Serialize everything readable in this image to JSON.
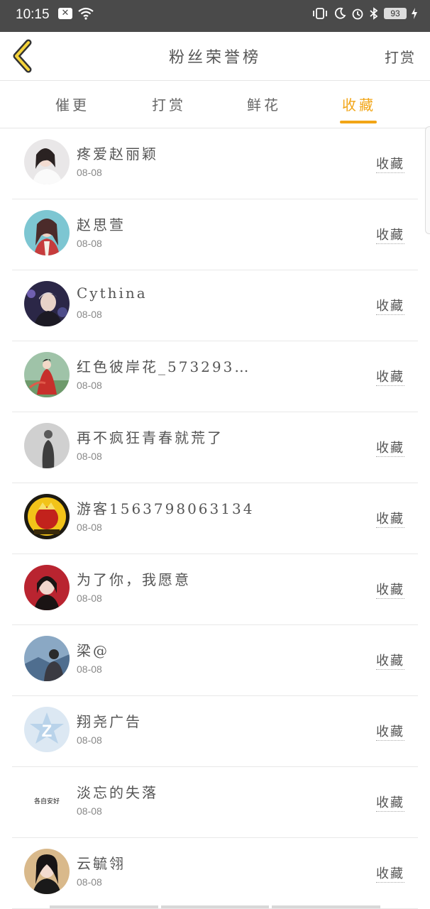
{
  "status_bar": {
    "time": "10:15",
    "battery": "93"
  },
  "header": {
    "title": "粉丝荣誉榜",
    "action": "打赏"
  },
  "tabs": [
    {
      "label": "催更"
    },
    {
      "label": "打赏"
    },
    {
      "label": "鲜花"
    },
    {
      "label": "收藏"
    }
  ],
  "active_tab": "收藏",
  "accent_color": "#f2a516",
  "rows": [
    {
      "name": "疼爱赵丽颖",
      "date": "08-08",
      "action": "收藏"
    },
    {
      "name": "赵思萱",
      "date": "08-08",
      "action": "收藏"
    },
    {
      "name": "Cythina",
      "date": "08-08",
      "action": "收藏"
    },
    {
      "name": "红色彼岸花_573293…",
      "date": "08-08",
      "action": "收藏"
    },
    {
      "name": "再不疯狂青春就荒了",
      "date": "08-08",
      "action": "收藏"
    },
    {
      "name": "游客1563798063134",
      "date": "08-08",
      "action": "收藏"
    },
    {
      "name": "为了你，我愿意",
      "date": "08-08",
      "action": "收藏"
    },
    {
      "name": "梁@",
      "date": "08-08",
      "action": "收藏"
    },
    {
      "name": "翔尧广告",
      "date": "08-08",
      "action": "收藏"
    },
    {
      "name": "淡忘的失落",
      "date": "08-08",
      "action": "收藏"
    },
    {
      "name": "云毓翎",
      "date": "08-08",
      "action": "收藏"
    }
  ],
  "avatar_text": {
    "row10": "各自安好"
  }
}
